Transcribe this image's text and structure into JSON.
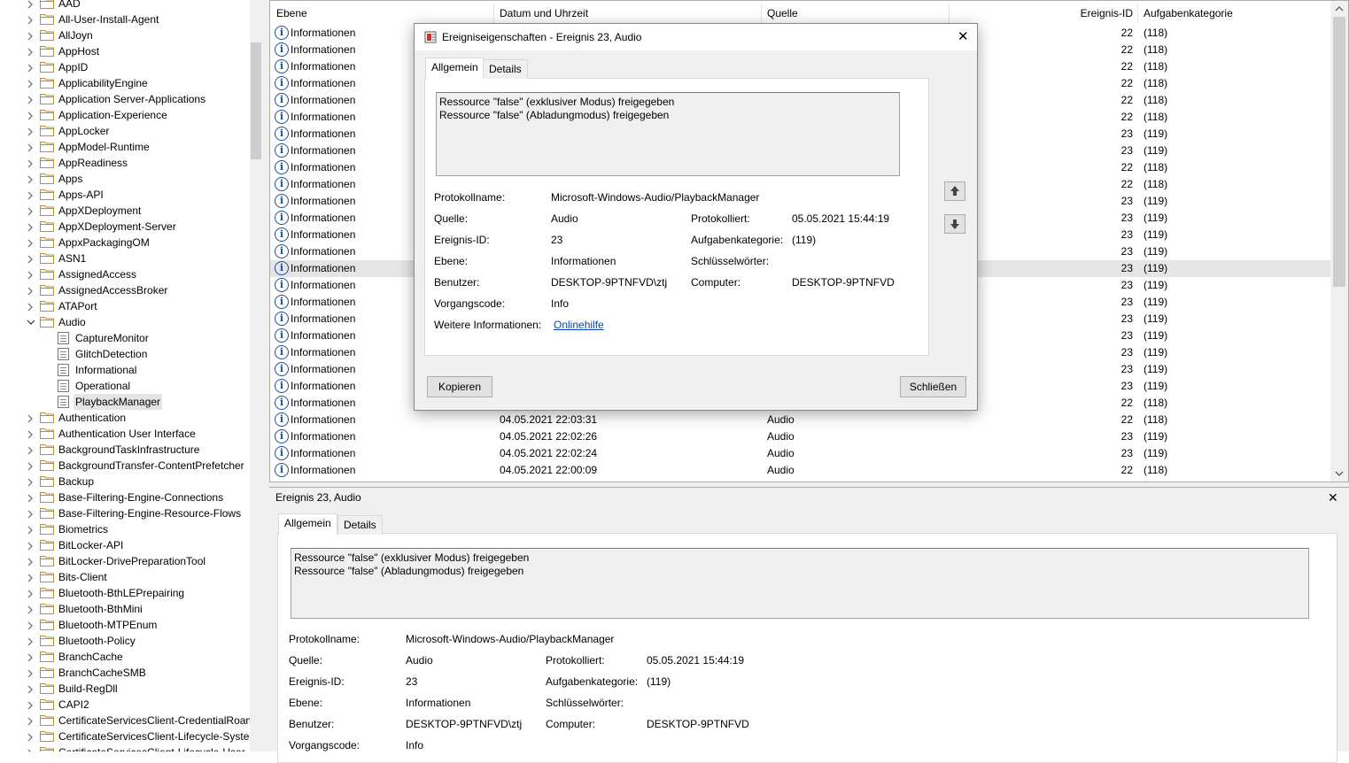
{
  "tree": {
    "items": [
      {
        "label": "AAD",
        "type": "folder",
        "expanded": false
      },
      {
        "label": "All-User-Install-Agent",
        "type": "folder",
        "expanded": false
      },
      {
        "label": "AllJoyn",
        "type": "folder",
        "expanded": false
      },
      {
        "label": "AppHost",
        "type": "folder",
        "expanded": false
      },
      {
        "label": "AppID",
        "type": "folder",
        "expanded": false
      },
      {
        "label": "ApplicabilityEngine",
        "type": "folder",
        "expanded": false
      },
      {
        "label": "Application Server-Applications",
        "type": "folder",
        "expanded": false
      },
      {
        "label": "Application-Experience",
        "type": "folder",
        "expanded": false
      },
      {
        "label": "AppLocker",
        "type": "folder",
        "expanded": false
      },
      {
        "label": "AppModel-Runtime",
        "type": "folder",
        "expanded": false
      },
      {
        "label": "AppReadiness",
        "type": "folder",
        "expanded": false
      },
      {
        "label": "Apps",
        "type": "folder",
        "expanded": false
      },
      {
        "label": "Apps-API",
        "type": "folder",
        "expanded": false
      },
      {
        "label": "AppXDeployment",
        "type": "folder",
        "expanded": false
      },
      {
        "label": "AppXDeployment-Server",
        "type": "folder",
        "expanded": false
      },
      {
        "label": "AppxPackagingOM",
        "type": "folder",
        "expanded": false
      },
      {
        "label": "ASN1",
        "type": "folder",
        "expanded": false
      },
      {
        "label": "AssignedAccess",
        "type": "folder",
        "expanded": false
      },
      {
        "label": "AssignedAccessBroker",
        "type": "folder",
        "expanded": false
      },
      {
        "label": "ATAPort",
        "type": "folder",
        "expanded": false
      },
      {
        "label": "Audio",
        "type": "folder",
        "expanded": true
      },
      {
        "label": "CaptureMonitor",
        "type": "log"
      },
      {
        "label": "GlitchDetection",
        "type": "log"
      },
      {
        "label": "Informational",
        "type": "log"
      },
      {
        "label": "Operational",
        "type": "log"
      },
      {
        "label": "PlaybackManager",
        "type": "log",
        "selected": true
      },
      {
        "label": "Authentication",
        "type": "folder",
        "expanded": false
      },
      {
        "label": "Authentication User Interface",
        "type": "folder",
        "expanded": false
      },
      {
        "label": "BackgroundTaskInfrastructure",
        "type": "folder",
        "expanded": false
      },
      {
        "label": "BackgroundTransfer-ContentPrefetcher",
        "type": "folder",
        "expanded": false
      },
      {
        "label": "Backup",
        "type": "folder",
        "expanded": false
      },
      {
        "label": "Base-Filtering-Engine-Connections",
        "type": "folder",
        "expanded": false
      },
      {
        "label": "Base-Filtering-Engine-Resource-Flows",
        "type": "folder",
        "expanded": false
      },
      {
        "label": "Biometrics",
        "type": "folder",
        "expanded": false
      },
      {
        "label": "BitLocker-API",
        "type": "folder",
        "expanded": false
      },
      {
        "label": "BitLocker-DrivePreparationTool",
        "type": "folder",
        "expanded": false
      },
      {
        "label": "Bits-Client",
        "type": "folder",
        "expanded": false
      },
      {
        "label": "Bluetooth-BthLEPrepairing",
        "type": "folder",
        "expanded": false
      },
      {
        "label": "Bluetooth-BthMini",
        "type": "folder",
        "expanded": false
      },
      {
        "label": "Bluetooth-MTPEnum",
        "type": "folder",
        "expanded": false
      },
      {
        "label": "Bluetooth-Policy",
        "type": "folder",
        "expanded": false
      },
      {
        "label": "BranchCache",
        "type": "folder",
        "expanded": false
      },
      {
        "label": "BranchCacheSMB",
        "type": "folder",
        "expanded": false
      },
      {
        "label": "Build-RegDll",
        "type": "folder",
        "expanded": false
      },
      {
        "label": "CAPI2",
        "type": "folder",
        "expanded": false
      },
      {
        "label": "CertificateServicesClient-CredentialRoam",
        "type": "folder",
        "expanded": false
      },
      {
        "label": "CertificateServicesClient-Lifecycle-Syster",
        "type": "folder",
        "expanded": false
      },
      {
        "label": "CertificateServicesClient-Lifecycle-User",
        "type": "folder",
        "expanded": false
      }
    ]
  },
  "grid": {
    "columns": {
      "level": "Ebene",
      "datetime": "Datum und Uhrzeit",
      "source": "Quelle",
      "eventid": "Ereignis-ID",
      "category": "Aufgabenkategorie"
    },
    "rows": [
      {
        "level": "Informationen",
        "datetime": "",
        "source": "",
        "eventid": "22",
        "category": "(118)"
      },
      {
        "level": "Informationen",
        "datetime": "",
        "source": "",
        "eventid": "22",
        "category": "(118)"
      },
      {
        "level": "Informationen",
        "datetime": "",
        "source": "",
        "eventid": "22",
        "category": "(118)"
      },
      {
        "level": "Informationen",
        "datetime": "",
        "source": "",
        "eventid": "22",
        "category": "(118)"
      },
      {
        "level": "Informationen",
        "datetime": "",
        "source": "",
        "eventid": "22",
        "category": "(118)"
      },
      {
        "level": "Informationen",
        "datetime": "",
        "source": "",
        "eventid": "22",
        "category": "(118)"
      },
      {
        "level": "Informationen",
        "datetime": "",
        "source": "",
        "eventid": "23",
        "category": "(119)"
      },
      {
        "level": "Informationen",
        "datetime": "",
        "source": "",
        "eventid": "23",
        "category": "(119)"
      },
      {
        "level": "Informationen",
        "datetime": "",
        "source": "",
        "eventid": "22",
        "category": "(118)"
      },
      {
        "level": "Informationen",
        "datetime": "",
        "source": "",
        "eventid": "22",
        "category": "(118)"
      },
      {
        "level": "Informationen",
        "datetime": "",
        "source": "",
        "eventid": "23",
        "category": "(119)"
      },
      {
        "level": "Informationen",
        "datetime": "",
        "source": "",
        "eventid": "23",
        "category": "(119)"
      },
      {
        "level": "Informationen",
        "datetime": "",
        "source": "",
        "eventid": "23",
        "category": "(119)"
      },
      {
        "level": "Informationen",
        "datetime": "",
        "source": "",
        "eventid": "23",
        "category": "(119)"
      },
      {
        "level": "Informationen",
        "datetime": "",
        "source": "",
        "eventid": "23",
        "category": "(119)",
        "selected": true
      },
      {
        "level": "Informationen",
        "datetime": "",
        "source": "",
        "eventid": "23",
        "category": "(119)"
      },
      {
        "level": "Informationen",
        "datetime": "",
        "source": "",
        "eventid": "23",
        "category": "(119)"
      },
      {
        "level": "Informationen",
        "datetime": "",
        "source": "",
        "eventid": "23",
        "category": "(119)"
      },
      {
        "level": "Informationen",
        "datetime": "",
        "source": "",
        "eventid": "23",
        "category": "(119)"
      },
      {
        "level": "Informationen",
        "datetime": "",
        "source": "",
        "eventid": "23",
        "category": "(119)"
      },
      {
        "level": "Informationen",
        "datetime": "",
        "source": "",
        "eventid": "23",
        "category": "(119)"
      },
      {
        "level": "Informationen",
        "datetime": "",
        "source": "",
        "eventid": "23",
        "category": "(119)"
      },
      {
        "level": "Informationen",
        "datetime": "",
        "source": "",
        "eventid": "22",
        "category": "(118)"
      },
      {
        "level": "Informationen",
        "datetime": "04.05.2021 22:03:31",
        "source": "Audio",
        "eventid": "22",
        "category": "(118)"
      },
      {
        "level": "Informationen",
        "datetime": "04.05.2021 22:02:26",
        "source": "Audio",
        "eventid": "23",
        "category": "(119)"
      },
      {
        "level": "Informationen",
        "datetime": "04.05.2021 22:02:24",
        "source": "Audio",
        "eventid": "23",
        "category": "(119)"
      },
      {
        "level": "Informationen",
        "datetime": "04.05.2021 22:00:09",
        "source": "Audio",
        "eventid": "22",
        "category": "(118)"
      }
    ]
  },
  "detail": {
    "title": "Ereignis 23, Audio",
    "close": "✕",
    "tab_general": "Allgemein",
    "tab_details": "Details",
    "message_line1": "Ressource \"false\" (exklusiver Modus) freigegeben",
    "message_line2": "Ressource \"false\" (Abladungmodus) freigegeben",
    "labels": {
      "logname": "Protokollname:",
      "source": "Quelle:",
      "eventid": "Ereignis-ID:",
      "level": "Ebene:",
      "user": "Benutzer:",
      "opcode": "Vorgangscode:",
      "more": "Weitere Informationen:",
      "logged": "Protokolliert:",
      "category": "Aufgabenkategorie:",
      "keywords": "Schlüsselwörter:",
      "computer": "Computer:"
    },
    "values": {
      "logname": "Microsoft-Windows-Audio/PlaybackManager",
      "source": "Audio",
      "eventid": "23",
      "level": "Informationen",
      "user": "DESKTOP-9PTNFVD\\ztj",
      "opcode": "Info",
      "logged": "05.05.2021 15:44:19",
      "category": "(119)",
      "keywords": "",
      "computer": "DESKTOP-9PTNFVD",
      "help_link": "Onlinehilfe"
    }
  },
  "dialog": {
    "title": "Ereigniseigenschaften - Ereignis 23, Audio",
    "close": "✕",
    "copy_button": "Kopieren",
    "close_button": "Schließen"
  },
  "colors": {
    "link": "#0645ad",
    "info_icon": "#1f4e9b",
    "folder": "#dcb35c",
    "selection": "#e5e5e5"
  }
}
